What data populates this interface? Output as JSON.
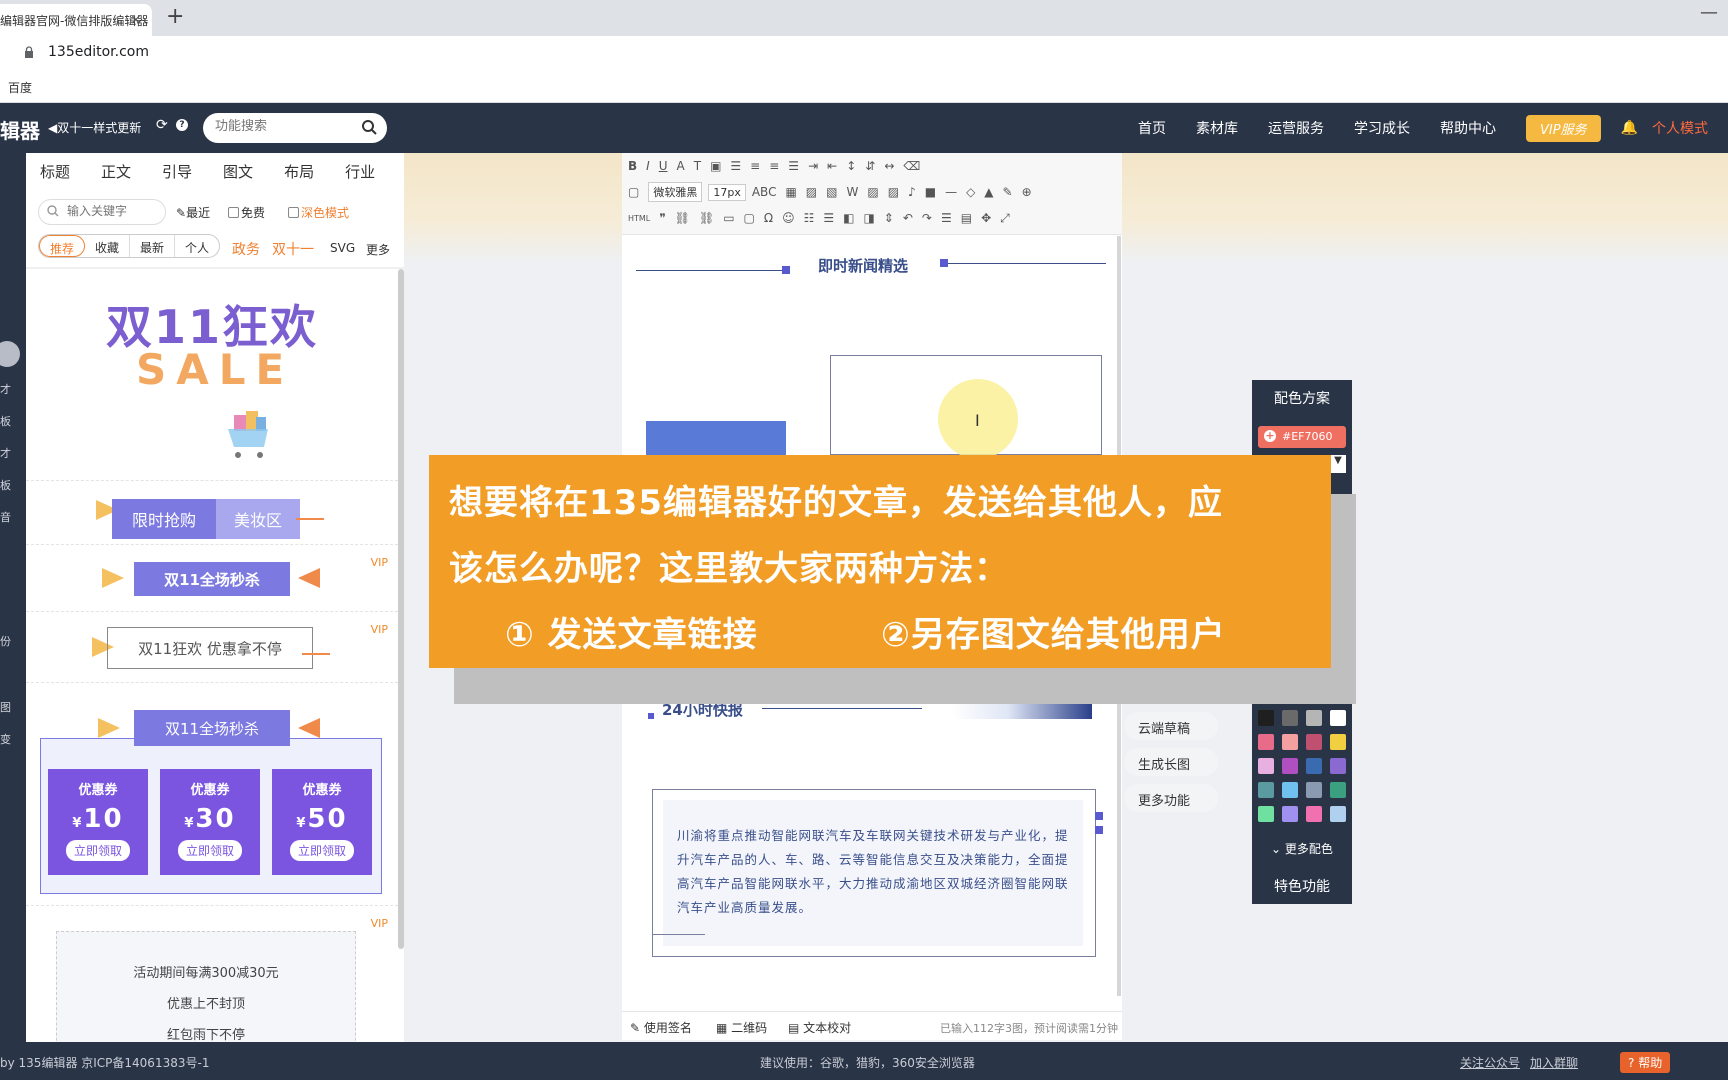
{
  "browser": {
    "tab_title": "编辑器官网-微信排版编辑器",
    "tab_close": "×",
    "new_tab": "+",
    "url": "135editor.com",
    "bookmark": "百度"
  },
  "nav": {
    "logo": "辑器",
    "update_notice": "双十一样式更新",
    "search_placeholder": "功能搜索",
    "links": [
      "首页",
      "素材库",
      "运营服务",
      "学习成长",
      "帮助中心"
    ],
    "vip": "VIP服务",
    "personal": "个人模式"
  },
  "rail": {
    "items": [
      "才",
      "板",
      "才",
      "板",
      "音",
      "份",
      "图",
      "变"
    ]
  },
  "left": {
    "categories": [
      "标题",
      "正文",
      "引导",
      "图文",
      "布局",
      "行业"
    ],
    "keyword_placeholder": "输入关键字",
    "recent": "最近",
    "free": "免费",
    "dark_mode": "深色模式",
    "sub_tabs": [
      "推荐",
      "收藏",
      "最新",
      "个人"
    ],
    "tag_gov": "政务",
    "tag_1111": "双十一",
    "tag_svg": "SVG",
    "tag_more": "更多",
    "templates": {
      "sale_title": "双11狂欢",
      "sale_word": "SALE",
      "flash_a": "限时抢购",
      "flash_b": "美妆区",
      "vip": "VIP",
      "seckill": "双11全场秒杀",
      "carnival": "双11狂欢  优惠拿不停",
      "coupons": [
        {
          "title": "优惠券",
          "currency": "¥",
          "value": "10",
          "btn": "立即领取"
        },
        {
          "title": "优惠券",
          "currency": "¥",
          "value": "30",
          "btn": "立即领取"
        },
        {
          "title": "优惠券",
          "currency": "¥",
          "value": "50",
          "btn": "立即领取"
        }
      ],
      "activity": [
        "活动期间每满300减30元",
        "优惠上不封顶",
        "红包雨下不停"
      ]
    }
  },
  "editor": {
    "font": "微软雅黑",
    "size": "17px",
    "news_title": "即时新闻精选",
    "snippet_title": "24小时快报",
    "paragraph": "川渝将重点推动智能网联汽车及车联网关键技术研发与产业化，提升汽车产品的人、车、路、云等智能信息交互及决策能力，全面提高汽车产品智能网联水平，大力推动成渝地区双城经济圈智能网联汽车产业高质量发展。",
    "signature": "使用签名",
    "qrcode": "二维码",
    "proofread": "文本校对",
    "stats": "已输入112字3图，预计阅读需1分钟"
  },
  "side_buttons": [
    "云端草稿",
    "生成长图",
    "更多功能"
  ],
  "color_panel": {
    "title": "配色方案",
    "hex": "#EF7060",
    "more": "更多配色",
    "feature": "特色功能",
    "swatches": [
      "#1f1f1f",
      "#6a6a6a",
      "#b5b5b5",
      "#ffffff",
      "#e86b8a",
      "#f4a0a0",
      "#c05070",
      "#f0d040",
      "#e8b0e0",
      "#b050c0",
      "#3a6ab0",
      "#8a6ad0",
      "#5a9aa0",
      "#70c0f0",
      "#8a9ab0",
      "#3aa080",
      "#70e0a0",
      "#a090f0",
      "#f070b0",
      "#b0d0f0"
    ]
  },
  "callout": {
    "line1": "想要将在135编辑器好的文章，发送给其他人，应",
    "line2": "该怎么办呢？这里教大家两种方法：",
    "method1": "①  发送文章链接",
    "method2": "②另存图文给其他用户"
  },
  "footer": {
    "copyright": "by 135编辑器  京ICP备14061383号-1",
    "suggest": "建议使用：谷歌，猎豹，360安全浏览器",
    "follow": "关注公众号",
    "join": "加入群聊",
    "help": "帮助"
  }
}
